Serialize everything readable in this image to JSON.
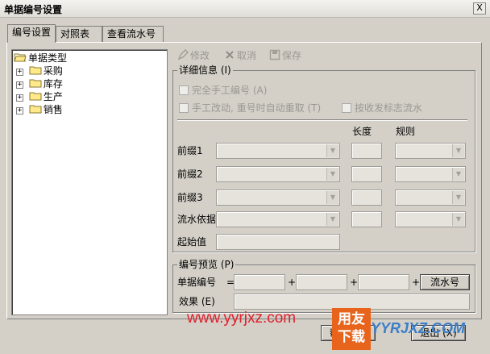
{
  "window": {
    "title": "单据编号设置",
    "close_label": "X"
  },
  "tabs": [
    {
      "label": "编号设置",
      "active": true
    },
    {
      "label": "对照表",
      "active": false
    },
    {
      "label": "查看流水号",
      "active": false
    }
  ],
  "tree": {
    "root": {
      "label": "单据类型",
      "icon": "open-folder-icon"
    },
    "items": [
      {
        "label": "采购",
        "expander": "+"
      },
      {
        "label": "库存",
        "expander": "+"
      },
      {
        "label": "生产",
        "expander": "+"
      },
      {
        "label": "销售",
        "expander": "+"
      }
    ]
  },
  "toolbar": {
    "modify": {
      "label": "修改",
      "icon": "edit-icon"
    },
    "cancel": {
      "label": "取消",
      "icon": "cancel-x-icon"
    },
    "save": {
      "label": "保存",
      "icon": "floppy-icon"
    }
  },
  "details": {
    "legend": "详细信息 (I)",
    "manual_number": {
      "label": "完全手工编号 (A)",
      "checked": false
    },
    "manual_change": {
      "label": "手工改动, 重号时自动重取 (T)",
      "checked": false
    },
    "serial_by_flag": {
      "label": "按收发标志流水",
      "checked": false
    },
    "col_length": "长度",
    "col_rule": "规则",
    "rows": [
      {
        "label": "前缀1",
        "value": "",
        "length": "",
        "rule": ""
      },
      {
        "label": "前缀2",
        "value": "",
        "length": "",
        "rule": ""
      },
      {
        "label": "前缀3",
        "value": "",
        "length": "",
        "rule": ""
      },
      {
        "label": "流水依据",
        "value": "",
        "length": "",
        "rule": ""
      }
    ],
    "start_label": "起始值",
    "start_value": ""
  },
  "preview": {
    "legend": "编号预览 (P)",
    "number_label": "单据编号",
    "equals": "=",
    "plus": "+",
    "serial_button": "流水号",
    "effect_label": "效果 (E)",
    "effect_value": ""
  },
  "footer": {
    "help_label": "帮助 (H)",
    "exit_label": "退出 (X)"
  },
  "watermark": {
    "url": "www.yyrjxz.com",
    "logo_top": "用友",
    "logo_bottom": "下载",
    "logo_text": "YYRJXZ.COM"
  },
  "colors": {
    "dialog_bg": "#d4d0c8",
    "disabled_text": "#9a9891",
    "watermark_red": "#e0202e",
    "logo_orange": "#e8641c"
  }
}
